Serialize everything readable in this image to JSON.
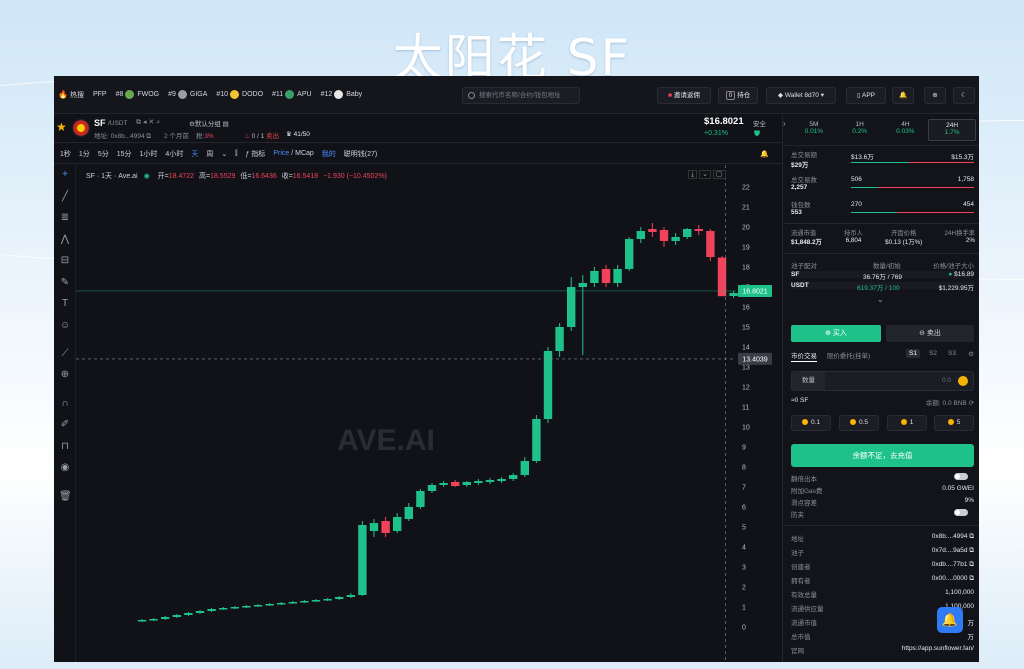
{
  "slide": {
    "title": "太阳花 SF"
  },
  "topbar": {
    "hot_label": "热搜",
    "hot_first": "PFP",
    "items": [
      {
        "rank": "#8",
        "name": "FWOG",
        "color": "#6aa84f"
      },
      {
        "rank": "#9",
        "name": "GIGA",
        "color": "#9aa0a6"
      },
      {
        "rank": "#10",
        "name": "DODO",
        "color": "#f1c232"
      },
      {
        "rank": "#11",
        "name": "APU",
        "color": "#38a169"
      },
      {
        "rank": "#12",
        "name": "Baby",
        "color": "#e6e6e6"
      }
    ],
    "search_placeholder": "搜索代币名称/合约/钱包地址",
    "invite": "邀请返佣",
    "holdings_count": "0",
    "holdings_label": "持仓",
    "wallet": "Wallet 8d70",
    "app": "APP"
  },
  "token": {
    "symbol": "SF",
    "pair": "/USDT",
    "address": "地址: 0x8b...4994",
    "age": "2 个月前",
    "tax": "税:3%",
    "tax_value": "3%",
    "fav": "默认分组",
    "sell_info": "0 / 1",
    "sell_label": "卖出",
    "holders_info": "41/50",
    "price": "$16.8021",
    "change": "+0.31%",
    "safe": "安全"
  },
  "timeframes": [
    "1秒",
    "1分",
    "5分",
    "15分",
    "1小时",
    "4小时",
    "天",
    "周"
  ],
  "active_timeframe": "天",
  "chart_tools": {
    "indicator": "指标",
    "price": "Price",
    "mcap": "MCap",
    "mine": "我的",
    "smart": "聪明钱(27)"
  },
  "chart_legend": {
    "title": "SF · 1天 · Ave.ai",
    "open_label": "开=",
    "open": "18.4722",
    "high_label": "高=",
    "high": "18.5529",
    "low_label": "低=",
    "low": "16.6436",
    "close_label": "收=",
    "close": "16.5418",
    "change": "−1.930 (−10.4502%)"
  },
  "watermark": "AVE.AI",
  "chart_data": {
    "type": "candlestick",
    "y_ticks": [
      0,
      1,
      2,
      3,
      4,
      5,
      6,
      7,
      8,
      9,
      10,
      11,
      12,
      13,
      14,
      15,
      16,
      17,
      18,
      19,
      20,
      21,
      22
    ],
    "ylim": [
      -1,
      22.5
    ],
    "current_price": "16.8021",
    "crosshair_price": "13.4039",
    "current_price_value": 16.8021,
    "crosshair_value": 13.4039,
    "candles": [
      {
        "o": 0.3,
        "h": 0.4,
        "l": 0.25,
        "c": 0.35
      },
      {
        "o": 0.35,
        "h": 0.45,
        "l": 0.3,
        "c": 0.4
      },
      {
        "o": 0.4,
        "h": 0.55,
        "l": 0.35,
        "c": 0.5
      },
      {
        "o": 0.5,
        "h": 0.65,
        "l": 0.45,
        "c": 0.6
      },
      {
        "o": 0.6,
        "h": 0.75,
        "l": 0.55,
        "c": 0.7
      },
      {
        "o": 0.7,
        "h": 0.85,
        "l": 0.65,
        "c": 0.8
      },
      {
        "o": 0.8,
        "h": 0.95,
        "l": 0.75,
        "c": 0.9
      },
      {
        "o": 0.9,
        "h": 1.0,
        "l": 0.85,
        "c": 0.95
      },
      {
        "o": 0.95,
        "h": 1.05,
        "l": 0.9,
        "c": 1.0
      },
      {
        "o": 1.0,
        "h": 1.1,
        "l": 0.95,
        "c": 1.05
      },
      {
        "o": 1.05,
        "h": 1.15,
        "l": 1.0,
        "c": 1.1
      },
      {
        "o": 1.1,
        "h": 1.2,
        "l": 1.05,
        "c": 1.15
      },
      {
        "o": 1.15,
        "h": 1.25,
        "l": 1.1,
        "c": 1.2
      },
      {
        "o": 1.2,
        "h": 1.3,
        "l": 1.15,
        "c": 1.25
      },
      {
        "o": 1.25,
        "h": 1.35,
        "l": 1.2,
        "c": 1.3
      },
      {
        "o": 1.3,
        "h": 1.4,
        "l": 1.25,
        "c": 1.35
      },
      {
        "o": 1.35,
        "h": 1.45,
        "l": 1.3,
        "c": 1.4
      },
      {
        "o": 1.4,
        "h": 1.55,
        "l": 1.35,
        "c": 1.5
      },
      {
        "o": 1.5,
        "h": 1.7,
        "l": 1.45,
        "c": 1.6
      },
      {
        "o": 1.6,
        "h": 5.3,
        "l": 1.55,
        "c": 5.1
      },
      {
        "o": 4.8,
        "h": 5.4,
        "l": 4.5,
        "c": 5.2
      },
      {
        "o": 5.3,
        "h": 5.5,
        "l": 4.5,
        "c": 4.7
      },
      {
        "o": 4.8,
        "h": 5.7,
        "l": 4.7,
        "c": 5.5
      },
      {
        "o": 5.4,
        "h": 6.2,
        "l": 5.3,
        "c": 6.0
      },
      {
        "o": 6.0,
        "h": 6.9,
        "l": 5.9,
        "c": 6.8
      },
      {
        "o": 6.8,
        "h": 7.2,
        "l": 6.7,
        "c": 7.1
      },
      {
        "o": 7.1,
        "h": 7.3,
        "l": 7.0,
        "c": 7.2
      },
      {
        "o": 7.25,
        "h": 7.35,
        "l": 7.0,
        "c": 7.05
      },
      {
        "o": 7.1,
        "h": 7.3,
        "l": 7.0,
        "c": 7.25
      },
      {
        "o": 7.2,
        "h": 7.4,
        "l": 7.1,
        "c": 7.3
      },
      {
        "o": 7.25,
        "h": 7.45,
        "l": 7.15,
        "c": 7.35
      },
      {
        "o": 7.3,
        "h": 7.5,
        "l": 7.2,
        "c": 7.4
      },
      {
        "o": 7.4,
        "h": 7.7,
        "l": 7.3,
        "c": 7.6
      },
      {
        "o": 7.6,
        "h": 8.5,
        "l": 7.5,
        "c": 8.3
      },
      {
        "o": 8.3,
        "h": 10.6,
        "l": 8.2,
        "c": 10.4
      },
      {
        "o": 10.4,
        "h": 14.0,
        "l": 10.2,
        "c": 13.8
      },
      {
        "o": 13.8,
        "h": 15.2,
        "l": 13.5,
        "c": 15.0
      },
      {
        "o": 15.0,
        "h": 17.5,
        "l": 14.8,
        "c": 17.0
      },
      {
        "o": 17.0,
        "h": 17.6,
        "l": 13.6,
        "c": 17.2
      },
      {
        "o": 17.2,
        "h": 18.0,
        "l": 17.0,
        "c": 17.8
      },
      {
        "o": 17.9,
        "h": 18.1,
        "l": 17.0,
        "c": 17.2
      },
      {
        "o": 17.2,
        "h": 18.1,
        "l": 17.0,
        "c": 17.9
      },
      {
        "o": 17.9,
        "h": 19.5,
        "l": 17.8,
        "c": 19.4
      },
      {
        "o": 19.4,
        "h": 20.0,
        "l": 19.2,
        "c": 19.8
      },
      {
        "o": 19.9,
        "h": 20.2,
        "l": 19.5,
        "c": 19.75
      },
      {
        "o": 19.85,
        "h": 20.0,
        "l": 19.0,
        "c": 19.3
      },
      {
        "o": 19.3,
        "h": 19.7,
        "l": 19.1,
        "c": 19.5
      },
      {
        "o": 19.5,
        "h": 19.95,
        "l": 19.4,
        "c": 19.9
      },
      {
        "o": 19.9,
        "h": 20.1,
        "l": 19.6,
        "c": 19.8
      },
      {
        "o": 19.8,
        "h": 19.9,
        "l": 18.3,
        "c": 18.5
      },
      {
        "o": 18.47,
        "h": 18.55,
        "l": 16.64,
        "c": 16.54
      },
      {
        "o": 16.55,
        "h": 16.8,
        "l": 16.45,
        "c": 16.7
      },
      {
        "o": 16.7,
        "h": 16.85,
        "l": 16.6,
        "c": 16.8
      }
    ]
  },
  "right": {
    "intervals": [
      {
        "label": "5M",
        "value": "0.01%"
      },
      {
        "label": "1H",
        "value": "0.2%"
      },
      {
        "label": "4H",
        "value": "0.03%"
      },
      {
        "label": "24H",
        "value": "1.7%"
      }
    ],
    "stats": [
      {
        "label": "总交易额",
        "total": "$29万",
        "buy": "$13.6万",
        "sell": "$15.3万",
        "buy_frac": 0.47
      },
      {
        "label": "总交易数",
        "total": "2,257",
        "buy": "506",
        "sell": "1,758",
        "buy_frac": 0.22
      },
      {
        "label": "钱包数",
        "total": "553",
        "buy": "270",
        "sell": "454",
        "buy_frac": 0.37
      }
    ],
    "metrics": [
      {
        "label": "流通市值",
        "value": "$1,848.2万"
      },
      {
        "label": "持币人",
        "value": "6,804"
      },
      {
        "label": "开盘价格",
        "value": "$0.13 (1万%)"
      },
      {
        "label": "24H换手率",
        "value": "2%"
      }
    ],
    "pool_header": {
      "pair": "池子配对",
      "qty": "数量/初始",
      "price": "价格/池子大小"
    },
    "pool": [
      {
        "name": "SF",
        "qty": "36.76万 / 769",
        "price": "$16.89"
      },
      {
        "name": "USDT",
        "qty": "619.37万 / 100",
        "price": "$1,229.95万"
      }
    ],
    "buy": "买入",
    "sell": "卖出",
    "order_tabs": [
      "市价交易",
      "限价委托(挂单)"
    ],
    "slots": [
      "S1",
      "S2",
      "S3"
    ],
    "qty_label": "数量",
    "qty_value": "0.0",
    "approx": "≈0 SF",
    "balance": "余额: 0.0 BNB",
    "amounts": [
      "0.1",
      "0.5",
      "1",
      "5"
    ],
    "insufficient": "余额不足，去充值",
    "toggles": [
      {
        "label": "翻倍出本",
        "value": ""
      },
      {
        "label": "附加Gas费",
        "value": "0.05 GWEI"
      },
      {
        "label": "滑点容差",
        "value": "9%"
      },
      {
        "label": "防夹",
        "value": ""
      }
    ],
    "info": [
      {
        "label": "地址",
        "value": "0x8b....4994"
      },
      {
        "label": "池子",
        "value": "0x7d....9a5d"
      },
      {
        "label": "创建者",
        "value": "0xdb....77b1"
      },
      {
        "label": "拥有者",
        "value": "0x00....0000"
      },
      {
        "label": "有效总量",
        "value": "1,100,000"
      },
      {
        "label": "流通供应量",
        "value": "1,100,000"
      },
      {
        "label": "流通市值",
        "value": "万"
      },
      {
        "label": "总市值",
        "value": "万"
      },
      {
        "label": "官网",
        "value": "https://app.sunflower.fan/"
      }
    ]
  },
  "colors": {
    "up": "#1fc18a",
    "down": "#f0425a",
    "accent": "#4a8cff",
    "bg": "#111217"
  }
}
